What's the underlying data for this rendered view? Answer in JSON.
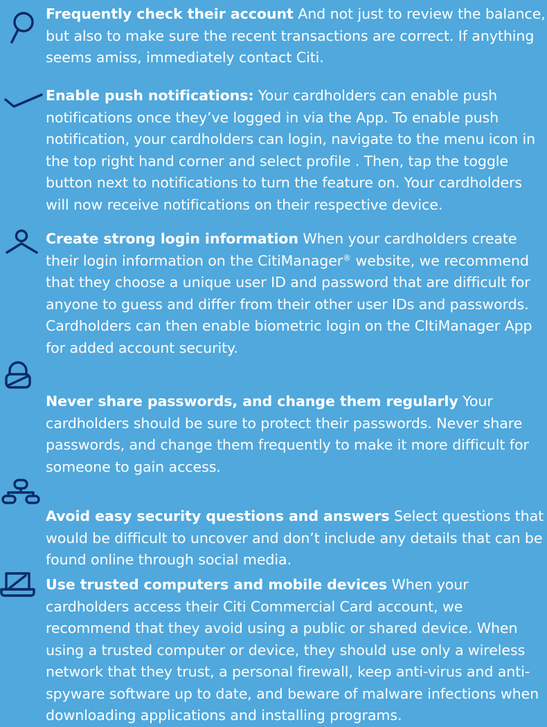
{
  "colors": {
    "background": "#50A8DC",
    "text": "#FFFFFF",
    "icon_stroke": "#0B2A66"
  },
  "tips": [
    {
      "icon": "magnifier-icon",
      "title": "Frequently check their account",
      "body": " And not just to review the balance, but also to make sure the recent transactions are correct. If anything seems amiss, immediately contact Citi."
    },
    {
      "icon": "checkmark-icon",
      "title": "Enable push notifications:",
      "body": " Your cardholders can enable push notifications once they’ve logged in via the App. To enable push notification, your cardholders can login, navigate to the menu icon in the top right hand corner and select profile . Then, tap the toggle button next to notifications to turn the feature on. Your cardholders will now receive notifications on their respective device."
    },
    {
      "icon": "user-icon",
      "title": "Create strong login information",
      "body_part1": " When your cardholders create their login information on the CitiManager",
      "body_reg": "®",
      "body_part2": " website, we recommend that they choose a unique user ID and password that are difficult for anyone to guess and differ from their other user IDs and passwords. Cardholders can then enable biometric login on the CItiManager App for added account security."
    },
    {
      "icon": "padlock-icon",
      "title": "Never share passwords, and change them regularly",
      "body": " Your cardholders should be sure to protect their passwords. Never share passwords, and change them frequently to make it more difficult for someone to gain access."
    },
    {
      "icon": "network-icon",
      "title": "Avoid easy security questions and answers",
      "body": " Select questions that would be difficult to uncover and don’t include any details that can be found online through social media."
    },
    {
      "icon": "laptop-icon",
      "title": "Use trusted computers and mobile devices",
      "body": " When your cardholders access their Citi Commercial Card account, we recommend that they avoid using a public or shared device. When using a trusted computer or device, they should use only a wireless network that they trust, a personal firewall, keep anti-virus and anti-spyware software up to date, and beware of malware infections when downloading applications and installing programs."
    }
  ]
}
